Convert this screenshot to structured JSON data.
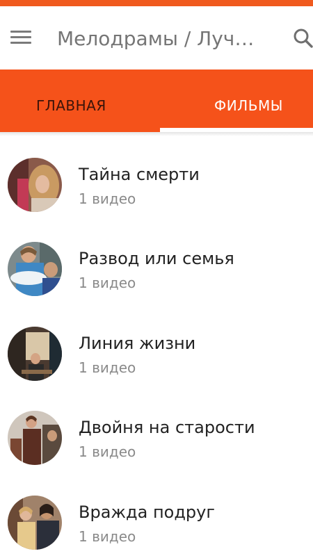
{
  "colors": {
    "accent": "#f5521a",
    "status_bar": "#f05a1e",
    "toolbar_bg": "#ffffff",
    "tab_inactive_text": "#3a140a",
    "tab_active_text": "#ffffff"
  },
  "toolbar": {
    "menu_icon": "hamburger-menu-icon",
    "title": "Мелодрамы / Лучшие",
    "search_icon": "search-icon"
  },
  "tabs": [
    {
      "label": "ГЛАВНАЯ",
      "active": false
    },
    {
      "label": "ФИЛЬМЫ",
      "active": true
    }
  ],
  "items": [
    {
      "title": "Тайна смерти",
      "subtitle": "1 видео"
    },
    {
      "title": "Развод или семья",
      "subtitle": "1 видео"
    },
    {
      "title": "Линия жизни",
      "subtitle": "1 видео"
    },
    {
      "title": "Двойня на старости",
      "subtitle": "1 видео"
    },
    {
      "title": "Вражда подруг",
      "subtitle": "1 видео"
    }
  ]
}
